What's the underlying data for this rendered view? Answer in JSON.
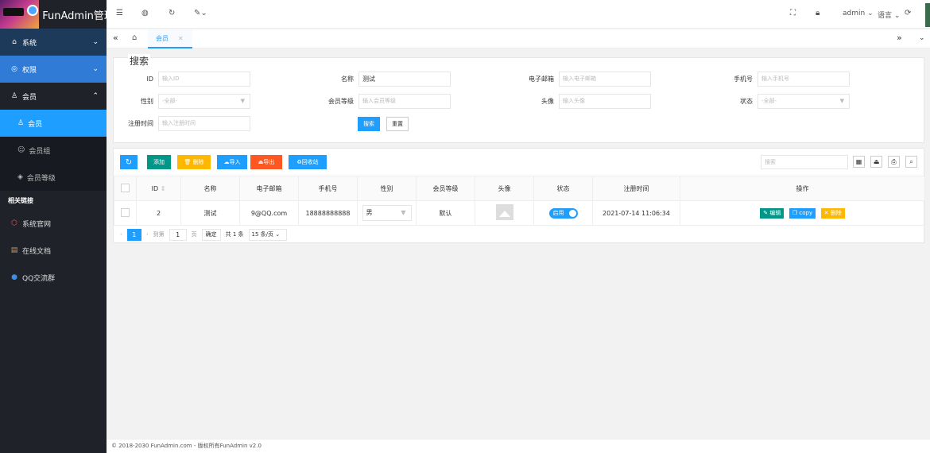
{
  "app": {
    "title": "FunAdmin管理"
  },
  "sidebar": {
    "menu": [
      {
        "label": "系统",
        "icon": "home-icon",
        "arrow": "⌄"
      },
      {
        "label": "权限",
        "icon": "shield-icon",
        "arrow": "⌄"
      },
      {
        "label": "会员",
        "icon": "user-icon",
        "arrow": "⌃"
      }
    ],
    "submenu": [
      {
        "label": "会员"
      },
      {
        "label": "会员组"
      },
      {
        "label": "会员等级"
      }
    ],
    "section_title": "相关链接",
    "links": [
      {
        "label": "系统官网"
      },
      {
        "label": "在线文档"
      },
      {
        "label": "QQ交流群"
      }
    ]
  },
  "header": {
    "user": "admin",
    "language": "语言"
  },
  "tabs": {
    "active": "会员"
  },
  "search": {
    "title": "搜索",
    "fields": [
      {
        "label": "ID",
        "placeholder": "输入ID",
        "value": ""
      },
      {
        "label": "名称",
        "placeholder": "",
        "value": "测试"
      },
      {
        "label": "电子邮箱",
        "placeholder": "输入电子邮箱",
        "value": ""
      },
      {
        "label": "手机号",
        "placeholder": "输入手机号",
        "value": ""
      },
      {
        "label": "性别",
        "placeholder": "-全部-",
        "value": ""
      },
      {
        "label": "会员等级",
        "placeholder": "输入会员等级",
        "value": ""
      },
      {
        "label": "头像",
        "placeholder": "输入头像",
        "value": ""
      },
      {
        "label": "状态",
        "placeholder": "-全部-",
        "value": ""
      },
      {
        "label": "注册时间",
        "placeholder": "输入注册时间",
        "value": ""
      }
    ],
    "search_button": "搜索",
    "reset_button": "重置"
  },
  "toolbar": {
    "add": "添加",
    "delete": "删除",
    "import": "导入",
    "export": "导出",
    "recycle": "回收站",
    "search_placeholder": "搜索",
    "colors": {
      "refresh": "#1E9FFF",
      "add": "#009688",
      "delete": "#FFB800",
      "import": "#1E9FFF",
      "export": "#FF5722",
      "recycle": "#1E9FFF"
    }
  },
  "table": {
    "headers": [
      "ID",
      "名称",
      "电子邮箱",
      "手机号",
      "性别",
      "会员等级",
      "头像",
      "状态",
      "注册时间",
      "操作"
    ],
    "rows": [
      {
        "id": "2",
        "name": "测试",
        "email": "9@QQ.com",
        "phone": "18888888888",
        "gender": "男",
        "level": "默认",
        "status": "启用",
        "register_time": "2021-07-14 11:06:34",
        "actions": [
          "编辑",
          "copy",
          "删除"
        ]
      }
    ]
  },
  "pager": {
    "current": "1",
    "goto_label": "到第",
    "goto_value": "1",
    "page_unit": "页",
    "confirm": "确定",
    "total": "共 1 条",
    "page_size": "15 条/页"
  },
  "footer": {
    "text": "© 2018-2030 FunAdmin.com - 版权所有FunAdmin v2.0"
  }
}
